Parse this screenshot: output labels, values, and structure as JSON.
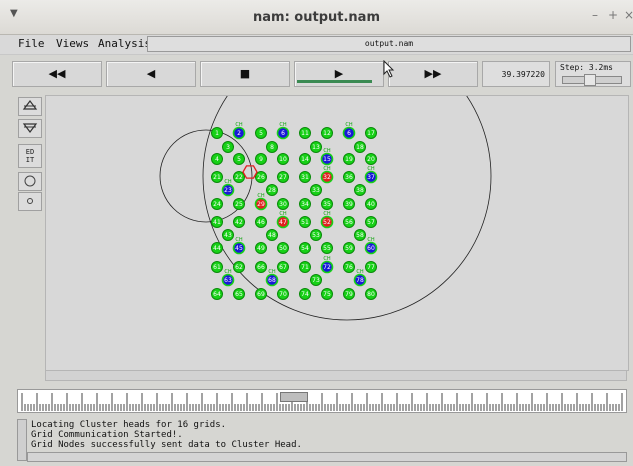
{
  "window": {
    "title": "nam: output.nam",
    "minimize": "–",
    "maximize": "+",
    "close": "×"
  },
  "menubar": {
    "items": [
      "File",
      "Views",
      "Analysis"
    ],
    "file_label": "output.nam"
  },
  "controls": {
    "rewind": "◀◀",
    "back": "◀",
    "stop": "■",
    "play": "▶",
    "fast_forward": "▶▶",
    "time": "39.397220",
    "step": "Step: 3.2ms",
    "progress": 0.85
  },
  "sidebar": {
    "zoom_in_icon": "zoom-in-icon",
    "zoom_out_icon": "zoom-out-icon",
    "edit_label_1": "ED",
    "edit_label_2": "IT"
  },
  "timeline": {
    "marker": "39.4"
  },
  "log": {
    "lines": [
      "Locating Cluster heads for 16 grids.",
      "Grid Communication Started!.",
      "Grid Nodes successfully sent data to Cluster Head."
    ]
  },
  "colors": {
    "node_green": "#17d117",
    "node_blue": "#1818d8",
    "node_red": "#e02020",
    "node_text": "#ffffff",
    "ch_label": "#0fa50f"
  },
  "network": {
    "ch_label": "CH",
    "nodes": [
      {
        "id": "1",
        "c": "g"
      },
      {
        "id": "2",
        "c": "b"
      },
      {
        "id": "5",
        "c": "g"
      },
      {
        "id": "6",
        "c": "b"
      },
      {
        "id": "11",
        "c": "g"
      },
      {
        "id": "12",
        "c": "g"
      },
      {
        "id": "6",
        "c": "b"
      },
      {
        "id": "17",
        "c": "g"
      },
      {
        "id": "3",
        "c": "g"
      },
      {
        "id": "8",
        "c": "g"
      },
      {
        "id": "13",
        "c": "g"
      },
      {
        "id": "18",
        "c": "g"
      },
      {
        "id": "4",
        "c": "g"
      },
      {
        "id": "5",
        "c": "g"
      },
      {
        "id": "9",
        "c": "g"
      },
      {
        "id": "10",
        "c": "g"
      },
      {
        "id": "14",
        "c": "g"
      },
      {
        "id": "15",
        "c": "b"
      },
      {
        "id": "19",
        "c": "g"
      },
      {
        "id": "20",
        "c": "g"
      },
      {
        "id": "21",
        "c": "g"
      },
      {
        "id": "22",
        "c": "g"
      },
      {
        "id": "26",
        "c": "g"
      },
      {
        "id": "27",
        "c": "g"
      },
      {
        "id": "31",
        "c": "g"
      },
      {
        "id": "32",
        "c": "r"
      },
      {
        "id": "36",
        "c": "g"
      },
      {
        "id": "37",
        "c": "b"
      },
      {
        "id": "23",
        "c": "b"
      },
      {
        "id": "28",
        "c": "g"
      },
      {
        "id": "33",
        "c": "g"
      },
      {
        "id": "38",
        "c": "g"
      },
      {
        "id": "24",
        "c": "g"
      },
      {
        "id": "25",
        "c": "g"
      },
      {
        "id": "29",
        "c": "r"
      },
      {
        "id": "30",
        "c": "g"
      },
      {
        "id": "34",
        "c": "g"
      },
      {
        "id": "35",
        "c": "g"
      },
      {
        "id": "39",
        "c": "g"
      },
      {
        "id": "40",
        "c": "g"
      },
      {
        "id": "41",
        "c": "g"
      },
      {
        "id": "42",
        "c": "g"
      },
      {
        "id": "46",
        "c": "g"
      },
      {
        "id": "47",
        "c": "r"
      },
      {
        "id": "51",
        "c": "g"
      },
      {
        "id": "52",
        "c": "r"
      },
      {
        "id": "56",
        "c": "g"
      },
      {
        "id": "57",
        "c": "g"
      },
      {
        "id": "43",
        "c": "g"
      },
      {
        "id": "48",
        "c": "g"
      },
      {
        "id": "53",
        "c": "g"
      },
      {
        "id": "58",
        "c": "g"
      },
      {
        "id": "44",
        "c": "g"
      },
      {
        "id": "45",
        "c": "b"
      },
      {
        "id": "49",
        "c": "g"
      },
      {
        "id": "50",
        "c": "g"
      },
      {
        "id": "54",
        "c": "g"
      },
      {
        "id": "55",
        "c": "g"
      },
      {
        "id": "59",
        "c": "g"
      },
      {
        "id": "60",
        "c": "b"
      },
      {
        "id": "61",
        "c": "g"
      },
      {
        "id": "62",
        "c": "g"
      },
      {
        "id": "66",
        "c": "g"
      },
      {
        "id": "67",
        "c": "g"
      },
      {
        "id": "71",
        "c": "g"
      },
      {
        "id": "72",
        "c": "b"
      },
      {
        "id": "76",
        "c": "g"
      },
      {
        "id": "77",
        "c": "g"
      },
      {
        "id": "63",
        "c": "b"
      },
      {
        "id": "68",
        "c": "b"
      },
      {
        "id": "73",
        "c": "g"
      },
      {
        "id": "78",
        "c": "b"
      },
      {
        "id": "64",
        "c": "g"
      },
      {
        "id": "65",
        "c": "g"
      },
      {
        "id": "69",
        "c": "g"
      },
      {
        "id": "70",
        "c": "g"
      },
      {
        "id": "74",
        "c": "g"
      },
      {
        "id": "75",
        "c": "g"
      },
      {
        "id": "79",
        "c": "g"
      },
      {
        "id": "80",
        "c": "g"
      }
    ]
  }
}
